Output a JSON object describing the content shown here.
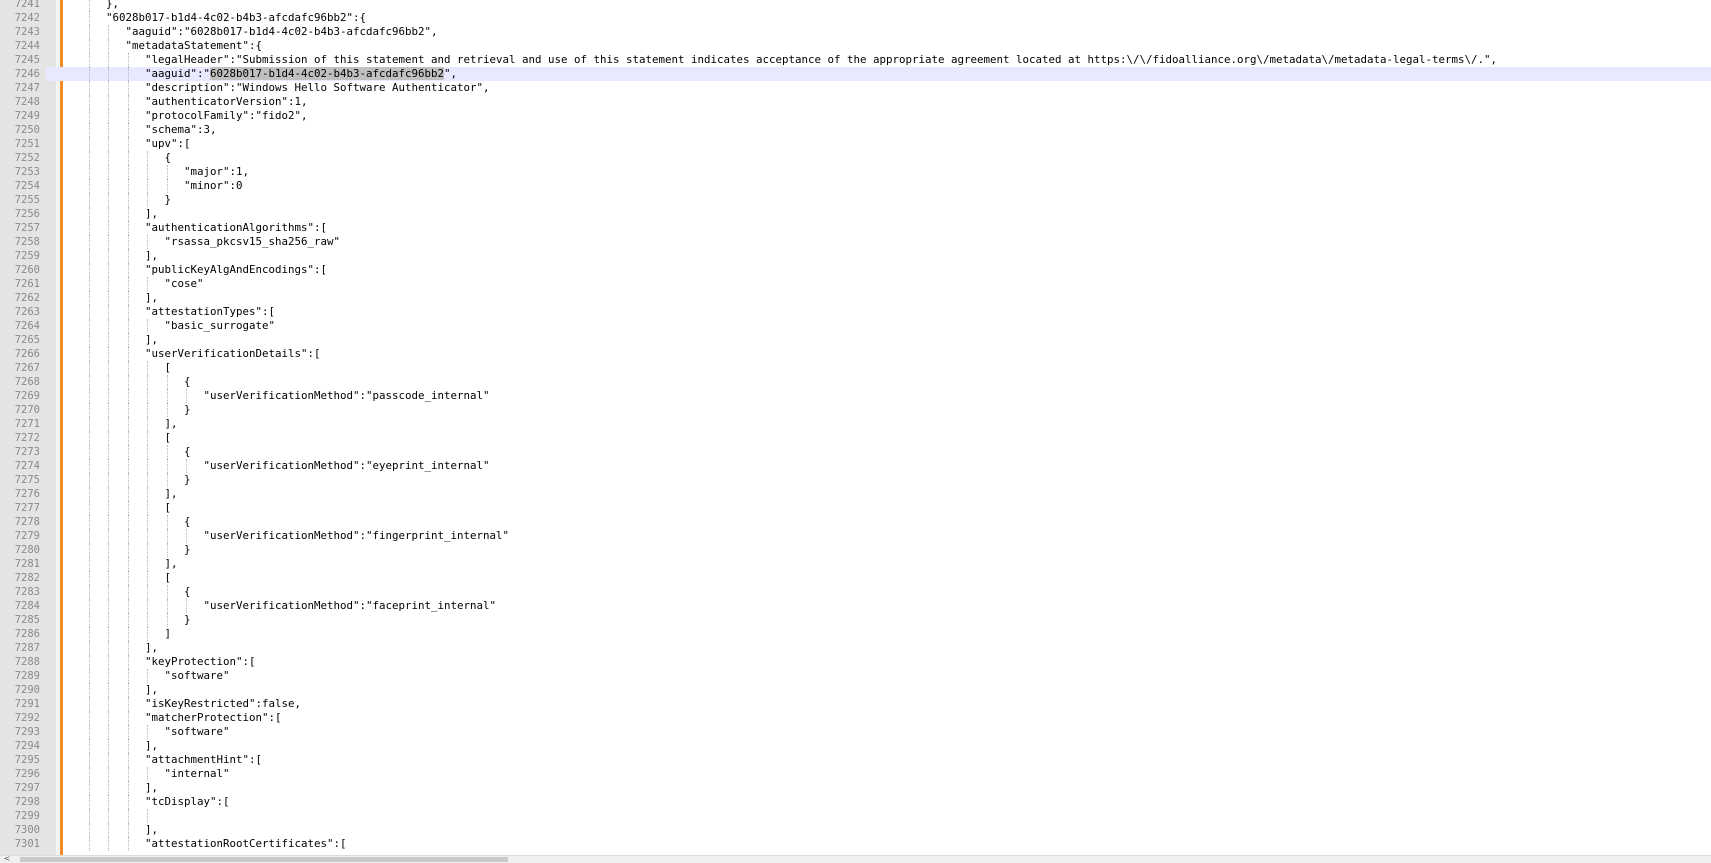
{
  "editor": {
    "highlight_line": 7246,
    "selected_text": "6028b017-b1d4-4c02-b4b3-afcdafc96bb2",
    "lines": [
      {
        "num": "7241",
        "indent": 2,
        "text": "},"
      },
      {
        "num": "7242",
        "indent": 2,
        "text": "\"6028b017-b1d4-4c02-b4b3-afcdafc96bb2\":{"
      },
      {
        "num": "7243",
        "indent": 3,
        "text": "\"aaguid\":\"6028b017-b1d4-4c02-b4b3-afcdafc96bb2\","
      },
      {
        "num": "7244",
        "indent": 3,
        "text": "\"metadataStatement\":{"
      },
      {
        "num": "7245",
        "indent": 4,
        "text": "\"legalHeader\":\"Submission of this statement and retrieval and use of this statement indicates acceptance of the appropriate agreement located at https:\\/\\/fidoalliance.org\\/metadata\\/metadata-legal-terms\\/.\","
      },
      {
        "num": "7246",
        "indent": 4,
        "text": "\"aaguid\":\"6028b017-b1d4-4c02-b4b3-afcdafc96bb2\",",
        "current": true
      },
      {
        "num": "7247",
        "indent": 4,
        "text": "\"description\":\"Windows Hello Software Authenticator\","
      },
      {
        "num": "7248",
        "indent": 4,
        "text": "\"authenticatorVersion\":1,"
      },
      {
        "num": "7249",
        "indent": 4,
        "text": "\"protocolFamily\":\"fido2\","
      },
      {
        "num": "7250",
        "indent": 4,
        "text": "\"schema\":3,"
      },
      {
        "num": "7251",
        "indent": 4,
        "text": "\"upv\":["
      },
      {
        "num": "7252",
        "indent": 5,
        "text": "{"
      },
      {
        "num": "7253",
        "indent": 6,
        "text": "\"major\":1,"
      },
      {
        "num": "7254",
        "indent": 6,
        "text": "\"minor\":0"
      },
      {
        "num": "7255",
        "indent": 5,
        "text": "}"
      },
      {
        "num": "7256",
        "indent": 4,
        "text": "],"
      },
      {
        "num": "7257",
        "indent": 4,
        "text": "\"authenticationAlgorithms\":["
      },
      {
        "num": "7258",
        "indent": 5,
        "text": "\"rsassa_pkcsv15_sha256_raw\""
      },
      {
        "num": "7259",
        "indent": 4,
        "text": "],"
      },
      {
        "num": "7260",
        "indent": 4,
        "text": "\"publicKeyAlgAndEncodings\":["
      },
      {
        "num": "7261",
        "indent": 5,
        "text": "\"cose\""
      },
      {
        "num": "7262",
        "indent": 4,
        "text": "],"
      },
      {
        "num": "7263",
        "indent": 4,
        "text": "\"attestationTypes\":["
      },
      {
        "num": "7264",
        "indent": 5,
        "text": "\"basic_surrogate\""
      },
      {
        "num": "7265",
        "indent": 4,
        "text": "],"
      },
      {
        "num": "7266",
        "indent": 4,
        "text": "\"userVerificationDetails\":["
      },
      {
        "num": "7267",
        "indent": 5,
        "text": "["
      },
      {
        "num": "7268",
        "indent": 6,
        "text": "{"
      },
      {
        "num": "7269",
        "indent": 7,
        "text": "\"userVerificationMethod\":\"passcode_internal\""
      },
      {
        "num": "7270",
        "indent": 6,
        "text": "}"
      },
      {
        "num": "7271",
        "indent": 5,
        "text": "],"
      },
      {
        "num": "7272",
        "indent": 5,
        "text": "["
      },
      {
        "num": "7273",
        "indent": 6,
        "text": "{"
      },
      {
        "num": "7274",
        "indent": 7,
        "text": "\"userVerificationMethod\":\"eyeprint_internal\""
      },
      {
        "num": "7275",
        "indent": 6,
        "text": "}"
      },
      {
        "num": "7276",
        "indent": 5,
        "text": "],"
      },
      {
        "num": "7277",
        "indent": 5,
        "text": "["
      },
      {
        "num": "7278",
        "indent": 6,
        "text": "{"
      },
      {
        "num": "7279",
        "indent": 7,
        "text": "\"userVerificationMethod\":\"fingerprint_internal\""
      },
      {
        "num": "7280",
        "indent": 6,
        "text": "}"
      },
      {
        "num": "7281",
        "indent": 5,
        "text": "],"
      },
      {
        "num": "7282",
        "indent": 5,
        "text": "["
      },
      {
        "num": "7283",
        "indent": 6,
        "text": "{"
      },
      {
        "num": "7284",
        "indent": 7,
        "text": "\"userVerificationMethod\":\"faceprint_internal\""
      },
      {
        "num": "7285",
        "indent": 6,
        "text": "}"
      },
      {
        "num": "7286",
        "indent": 5,
        "text": "]"
      },
      {
        "num": "7287",
        "indent": 4,
        "text": "],"
      },
      {
        "num": "7288",
        "indent": 4,
        "text": "\"keyProtection\":["
      },
      {
        "num": "7289",
        "indent": 5,
        "text": "\"software\""
      },
      {
        "num": "7290",
        "indent": 4,
        "text": "],"
      },
      {
        "num": "7291",
        "indent": 4,
        "text": "\"isKeyRestricted\":false,"
      },
      {
        "num": "7292",
        "indent": 4,
        "text": "\"matcherProtection\":["
      },
      {
        "num": "7293",
        "indent": 5,
        "text": "\"software\""
      },
      {
        "num": "7294",
        "indent": 4,
        "text": "],"
      },
      {
        "num": "7295",
        "indent": 4,
        "text": "\"attachmentHint\":["
      },
      {
        "num": "7296",
        "indent": 5,
        "text": "\"internal\""
      },
      {
        "num": "7297",
        "indent": 4,
        "text": "],"
      },
      {
        "num": "7298",
        "indent": 4,
        "text": "\"tcDisplay\":["
      },
      {
        "num": "7299",
        "indent": 5,
        "text": ""
      },
      {
        "num": "7300",
        "indent": 4,
        "text": "],"
      },
      {
        "num": "7301",
        "indent": 4,
        "text": "\"attestationRootCertificates\":["
      }
    ]
  },
  "scrollbar": {
    "left_arrow": "<"
  }
}
